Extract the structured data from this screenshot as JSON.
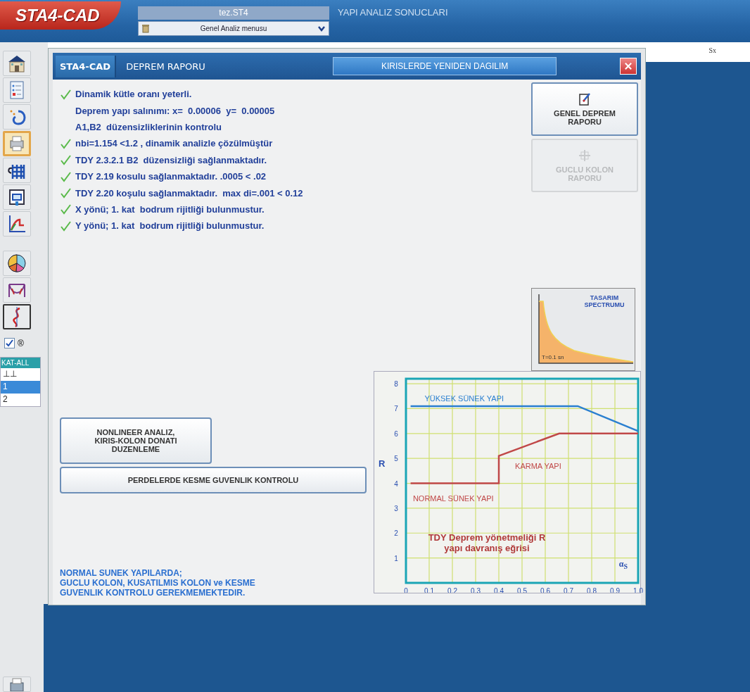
{
  "top_bar": {
    "logo": "STA4-CAD",
    "file_name": "tez.ST4",
    "menu": {
      "value": "Genel Analiz menusu"
    },
    "title": "YAPI ANALIZ SONUCLARI"
  },
  "toolbar": {
    "tools": [
      {
        "selected": false,
        "pressed": false
      },
      {
        "selected": false,
        "pressed": false
      },
      {
        "selected": false,
        "pressed": false
      },
      {
        "selected": true,
        "pressed": false
      },
      {
        "selected": false,
        "pressed": false
      },
      {
        "selected": false,
        "pressed": false
      },
      {
        "selected": false,
        "pressed": false
      },
      {
        "selected": false,
        "pressed": false
      },
      {
        "selected": false,
        "pressed": false
      },
      {
        "selected": false,
        "pressed": true
      },
      {
        "selected": false,
        "pressed": false
      }
    ],
    "checkbox": {
      "label": "®",
      "checked": true
    },
    "floor_list": {
      "header": "KAT-ALL",
      "items": [
        {
          "label": "⊥⊥",
          "selected": false
        },
        {
          "label": "1",
          "selected": true
        },
        {
          "label": "2",
          "selected": false
        }
      ]
    }
  },
  "right_panel": {
    "label": "Sx"
  },
  "dialog": {
    "tab": "STA4-CAD",
    "title": "DEPREM RAPORU",
    "header_button": "KIRISLERDE YENIDEN DAGILIM",
    "checks": [
      {
        "text": "Dinamik kütle oranı yeterli.",
        "checked": true
      },
      {
        "text": "Deprem yapı salınımı: x=  0.00006  y=  0.00005",
        "checked": false
      },
      {
        "text": "A1,B2  düzensizliklerinin kontrolu",
        "checked": false
      },
      {
        "text": "nbi=1.154 <1.2 , dinamik analizle çözülmüştür",
        "checked": true
      },
      {
        "text": "TDY 2.3.2.1 B2  düzensizliği sağlanmaktadır.",
        "checked": true
      },
      {
        "text": "TDY 2.19 kosulu sağlanmaktadır. .0005 < .02",
        "checked": true
      },
      {
        "text": "TDY 2.20 koşulu sağlanmaktadır.  max di=.001 < 0.12",
        "checked": true
      },
      {
        "text": "X yönü; 1. kat  bodrum rijitliği bulunmustur.",
        "checked": true
      },
      {
        "text": "Y yönü; 1. kat  bodrum rijitliği bulunmustur.",
        "checked": true
      }
    ],
    "side_buttons": [
      {
        "label": "GENEL DEPREM RAPORU",
        "disabled": false
      },
      {
        "label": "GUCLU KOLON RAPORU",
        "disabled": true
      }
    ],
    "spectrum": {
      "title": "TASARIM SPECTRUMU",
      "caption": "T=0.1 sn"
    },
    "action_buttons": [
      "NONLINEER ANALIZ, KIRIS-KOLON DONATI DUZENLEME",
      "PERDELERDE KESME GUVENLIK KONTROLU"
    ],
    "note": [
      "NORMAL SUNEK YAPILARDA;",
      "GUCLU KOLON, KUSATILMIS KOLON ve KESME GUVENLIK KONTROLU GEREKMEMEKTEDIR."
    ],
    "chart_data": {
      "type": "line",
      "title": "TDY Deprem yönetmeliği R yapı davranış eğrisi",
      "xlabel": "α$_{S}$",
      "ylabel": "R",
      "x": [
        0.02,
        0.4,
        0.4,
        0.66,
        0.74,
        1.0
      ],
      "series": [
        {
          "color": "#2a7fd0",
          "values": [
            7.1,
            7.1,
            7.1,
            7.1,
            7.1,
            6.1
          ]
        },
        {
          "color": "#c04848",
          "values": [
            4,
            4,
            5.1,
            6,
            6,
            6
          ]
        }
      ],
      "xlim": [
        0,
        1
      ],
      "ylim": [
        0,
        8.2
      ],
      "xticks": [
        0,
        0.1,
        0.2,
        0.3,
        0.4,
        0.5,
        0.6,
        0.7,
        0.8,
        0.9,
        {
          "value": 1,
          "label": "1.0"
        }
      ],
      "yticks": [
        1,
        2,
        3,
        4,
        5,
        6,
        7,
        8
      ],
      "grid": true,
      "annotations": [
        "YÜKSEK SÜNEK YAPI",
        "KARMA YAPI",
        "NORMAL SÜNEK YAPI"
      ]
    }
  }
}
